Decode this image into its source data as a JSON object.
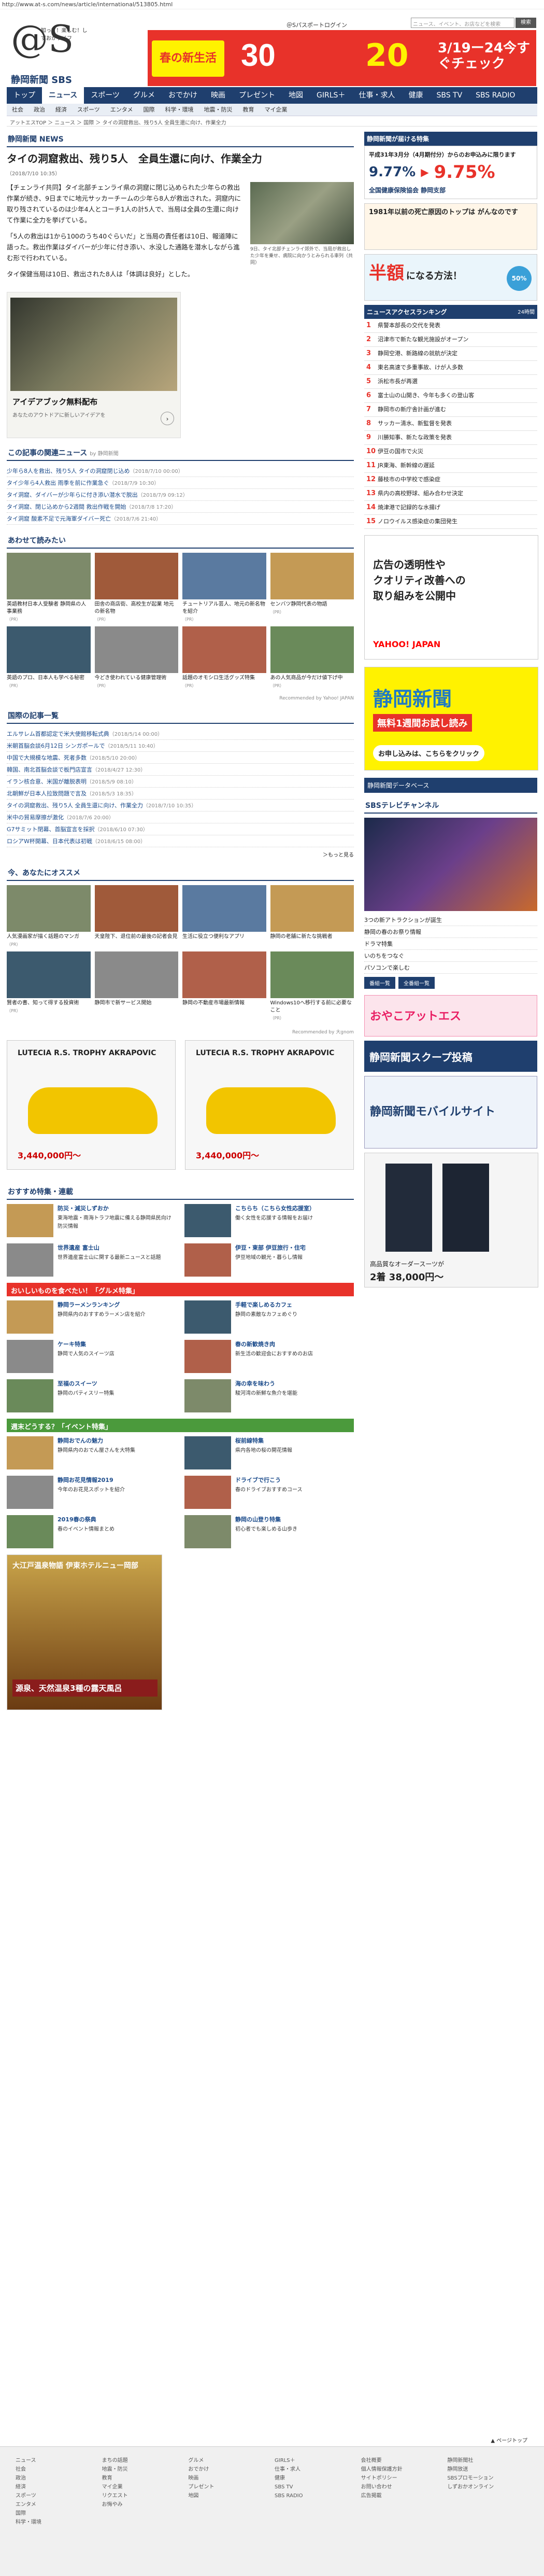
{
  "url": "http://www.at-s.com/news/article/international/513805.html",
  "header": {
    "logo_text": "@S",
    "logo_sub": "知って！楽しむ！しずおかライフ",
    "site_name": "静岡新聞 SBS",
    "toplinks": "＠Sパスポートログイン",
    "search_placeholder": "ニュース、イベント、お店などを検索",
    "search_button": "検索"
  },
  "top_banner": {
    "label": "春の新生活",
    "text1": "30",
    "text2": "20",
    "text3": "3/19ー24今すぐチェック"
  },
  "nav": [
    "トップ",
    "ニュース",
    "スポーツ",
    "グルメ",
    "おでかけ",
    "映画",
    "プレゼント",
    "地図",
    "GIRLS＋",
    "仕事・求人",
    "健康",
    "SBS TV",
    "SBS RADIO"
  ],
  "subnav": [
    "社会",
    "政治",
    "経済",
    "スポーツ",
    "エンタメ",
    "国際",
    "科学・環境",
    "地震・防災",
    "教育",
    "マイ企業"
  ],
  "breadcrumb": "アットエスTOP ＞ ニュース ＞ 国際 ＞ タイの洞窟救出、残り5人 全員生還に向け、作業全力",
  "brand_label": "静岡新聞",
  "brand_section": "NEWS",
  "article": {
    "title": "タイの洞窟救出、残り5人　全員生還に向け、作業全力",
    "date": "（2018/7/10 10:35）",
    "photo_caption": "9日、タイ北部チェンライ郊外で、当局が救出した少年を乗せ、病院に向かうとみられる車列（共同）",
    "paragraphs": [
      "【チェンライ共同】タイ北部チェンライ県の洞窟に閉じ込められた少年らの救出作業が続き、9日までに地元サッカーチームの少年ら8人が救出された。洞窟内に取り残されているのは少年4人とコーチ1人の計5人で、当局は全員の生還に向けて作業に全力を挙げている。",
      "「5人の救出は1から100のうち40ぐらいだ」と当局の責任者は10日、報道陣に語った。救出作業はダイバーが少年に付き添い、水没した通路を潜水しながら進む形で行われている。",
      "タイ保健当局は10日、救出された8人は「体調は良好」とした。"
    ]
  },
  "ad_left": {
    "title": "アイデアブック無料配布",
    "sub": "あなたのアウトドアに新しいアイデアを"
  },
  "related": {
    "head": "この記事の関連ニュース",
    "by": "by 静岡新聞",
    "items": [
      {
        "text": "少年ら8人を救出、残り5人 タイの洞窟閉じ込め",
        "date": "（2018/7/10 00:00）"
      },
      {
        "text": "タイ少年ら4人救出 雨季を前に作業急ぐ",
        "date": "（2018/7/9 10:30）"
      },
      {
        "text": "タイ洞窟、ダイバーが少年らに付き添い潜水で脱出",
        "date": "（2018/7/9 09:12）"
      },
      {
        "text": "タイ洞窟、閉じ込めから2週間 救出作戦を開始",
        "date": "（2018/7/8 17:20）"
      },
      {
        "text": "タイ洞窟 酸素不足で元海軍ダイバー死亡",
        "date": "（2018/7/6 21:40）"
      }
    ]
  },
  "recommend_head": "あわせて読みたい",
  "recommend": [
    {
      "t": "英語教材日本人受験者 静岡県の人事業務",
      "s": "（PR）"
    },
    {
      "t": "田舎の商店街、高校生が起業 地元の新名物",
      "s": "（PR）"
    },
    {
      "t": "チュートリアル芸人、地元の新名物を紹介",
      "s": "（PR）"
    },
    {
      "t": "センバツ静岡代表の物語",
      "s": "（PR）"
    },
    {
      "t": "英語のプロ、日本人も学べる秘密",
      "s": "（PR）"
    },
    {
      "t": "今どき使われている健康管理術",
      "s": "（PR）"
    },
    {
      "t": "話題のオモシロ生活グッズ特集",
      "s": "（PR）"
    },
    {
      "t": "あの人気商品が今だけ値下げ中",
      "s": "（PR）"
    }
  ],
  "recommend_note": "Recommended by Yahoo! JAPAN",
  "intl_head": "国際の記事一覧",
  "intl": [
    {
      "text": "エルサレム首都認定で米大使館移転式典",
      "date": "（2018/5/14 00:00）"
    },
    {
      "text": "米朝首脳会談6月12日 シンガポールで",
      "date": "（2018/5/11 10:40）"
    },
    {
      "text": "中国で大規模な地震、死者多数",
      "date": "（2018/5/10 20:00）"
    },
    {
      "text": "韓国、南北首脳会談で板門店宣言",
      "date": "（2018/4/27 12:30）"
    },
    {
      "text": "イラン核合意、米国が離脱表明",
      "date": "（2018/5/9 08:10）"
    },
    {
      "text": "北朝鮮が日本人拉致問題で言及",
      "date": "（2018/5/3 18:35）"
    },
    {
      "text": "タイの洞窟救出、残り5人 全員生還に向け、作業全力",
      "date": "（2018/7/10 10:35）"
    },
    {
      "text": "米中の貿易摩擦が激化",
      "date": "（2018/7/6 20:00）"
    },
    {
      "text": "G7サミット閉幕、首脳宣言を採択",
      "date": "（2018/6/10 07:30）"
    },
    {
      "text": "ロシアW杯開幕、日本代表は初戦",
      "date": "（2018/6/15 08:00）"
    }
  ],
  "more": "＞もっと見る",
  "osusume_head": "今、あなたにオススメ",
  "osusume": [
    {
      "t": "人気漫画家が描く話題のマンガ",
      "s": "（PR）"
    },
    {
      "t": "天皇陛下、退位前の最後の記者会見",
      "s": ""
    },
    {
      "t": "生活に役立つ便利なアプリ",
      "s": ""
    },
    {
      "t": "静岡の老舗に新たな挑戦者",
      "s": ""
    },
    {
      "t": "賢者の書、知って得する投資術",
      "s": "（PR）"
    },
    {
      "t": "静岡市で新サービス開始",
      "s": ""
    },
    {
      "t": "静岡の不動産市場最新情報",
      "s": ""
    },
    {
      "t": "Windows10へ移行する前に必要なこと",
      "s": "（PR）"
    }
  ],
  "osusume_note": "Recommended by 大gnom",
  "car_ad": {
    "title": "LUTECIA R.S. TROPHY AKRAPOVIC",
    "price": "3,440,000円〜"
  },
  "tokushu_head": "おすすめ特集・連載",
  "tokushu": [
    {
      "t": "防災・減災しずおか",
      "d": "東海地震・南海トラフ地震に備える静岡県民向け防災情報"
    },
    {
      "t": "こちらち（こちら女性応援室）",
      "d": "働く女性を応援する情報をお届け"
    },
    {
      "t": "世界遺産 富士山",
      "d": "世界遺産富士山に関する最新ニュースと話題"
    },
    {
      "t": "伊豆・東部 伊豆旅行・住宅",
      "d": "伊豆地域の観光・暮らし情報"
    }
  ],
  "gourmet_head": "おいしいものを食べたい！「グルメ特集」",
  "gourmet": [
    {
      "t": "静岡ラーメンランキング",
      "d": "静岡県内のおすすめラーメン店を紹介"
    },
    {
      "t": "手軽で楽しめるカフェ",
      "d": "静岡の素敵なカフェめぐり"
    },
    {
      "t": "ケーキ特集",
      "d": "静岡で人気のスイーツ店"
    },
    {
      "t": "春の新歓焼き肉",
      "d": "新生活の歓迎会におすすめのお店"
    },
    {
      "t": "至福のスイーツ",
      "d": "静岡のパティスリー特集"
    },
    {
      "t": "海の幸を味わう",
      "d": "駿河湾の新鮮な魚介を堪能"
    }
  ],
  "event_head": "週末どうする？「イベント特集」",
  "event": [
    {
      "t": "静岡おでんの魅力",
      "d": "静岡県内のおでん屋さんを大特集"
    },
    {
      "t": "桜前線特集",
      "d": "県内各地の桜の開花情報"
    },
    {
      "t": "静岡お花見情報2019",
      "d": "今年のお花見スポットを紹介"
    },
    {
      "t": "ドライブで行こう",
      "d": "春のドライブおすすめコース"
    },
    {
      "t": "2019春の祭典",
      "d": "春のイベント情報まとめ"
    },
    {
      "t": "静岡の山登り特集",
      "d": "初心者でも楽しめる山歩き"
    }
  ],
  "hotel_ad": {
    "name": "大江戸温泉物語 伊東ホテルニュー岡部",
    "sub": "源泉、天然温泉3種の露天風呂"
  },
  "right": {
    "campaign_head": "静岡新聞が届ける特集",
    "loan_text": "平成31年3月分（4月期付分）からのお申込みに限ります",
    "rate1": "9.77%",
    "rate_arrow": "▶",
    "rate2": "9.75%",
    "company": "全国健康保険協会 静岡支部",
    "book_title": "1981年以前の死亡原因のトップは がんなのです",
    "discount": "半額",
    "discount_sub": "になる方法！",
    "percent": "50%",
    "rank_head": "ニュースアクセスランキング",
    "rank_period": "24時間",
    "ranking": [
      "県警本部長の交代を発表",
      "沼津市で新たな観光施設がオープン",
      "静岡空港、新路線の就航が決定",
      "東名高速で多重事故、けが人多数",
      "浜松市長が再選",
      "富士山の山開き、今年も多くの登山客",
      "静岡市の新庁舎計画が進む",
      "サッカー清水、新監督を発表",
      "川勝知事、新たな政策を発表",
      "伊豆の国市で火災",
      "JR東海、新幹線の遅延",
      "藤枝市の中学校で感染症",
      "県内の高校野球、組み合わせ決定",
      "焼津港で記録的な水揚げ",
      "ノロウイルス感染症の集団発生"
    ],
    "yahoo_ad": {
      "line1": "広告の透明性や",
      "line2": "クオリティ改善への",
      "line3": "取り組みを公開中",
      "brand": "YAHOO! JAPAN"
    },
    "shizuoka_paper": {
      "title": "静岡新聞",
      "sub": "無料1週間お試し読み",
      "btn": "お申し込みは、こちらをクリック"
    },
    "database": "静岡新聞データベース",
    "tv_head": "SBSテレビチャンネル",
    "tv_items": [
      "3つの新アトラクションが誕生",
      "静岡の春のお祭り情報",
      "ドラマ特集",
      "いのちをつなぐ",
      "パソコンで楽しむ"
    ],
    "tv_btn1": "番組一覧",
    "tv_btn2": "全番組一覧",
    "oyako": "おやこアットエス",
    "scoop": "静岡新聞スクープ投稿",
    "mobile": "静岡新聞モバイルサイト",
    "suit": {
      "title": "高品質なオーダースーツが",
      "price": "2着 38,000円〜"
    }
  },
  "footer": [
    [
      "ニュース",
      "社会",
      "政治",
      "経済",
      "スポーツ",
      "エンタメ",
      "国際",
      "科学・環境"
    ],
    [
      "まちの話題",
      "地震・防災",
      "教育",
      "マイ企業",
      "リクエスト",
      "お悔やみ"
    ],
    [
      "グルメ",
      "おでかけ",
      "映画",
      "プレゼント",
      "地図"
    ],
    [
      "GIRLS＋",
      "仕事・求人",
      "健康",
      "SBS TV",
      "SBS RADIO"
    ],
    [
      "会社概要",
      "個人情報保護方針",
      "サイトポリシー",
      "お問い合わせ",
      "広告掲載"
    ],
    [
      "静岡新聞社",
      "静岡放送",
      "SBSプロモーション",
      "しずおかオンライン"
    ]
  ],
  "pagetop": "▲ ページトップ"
}
